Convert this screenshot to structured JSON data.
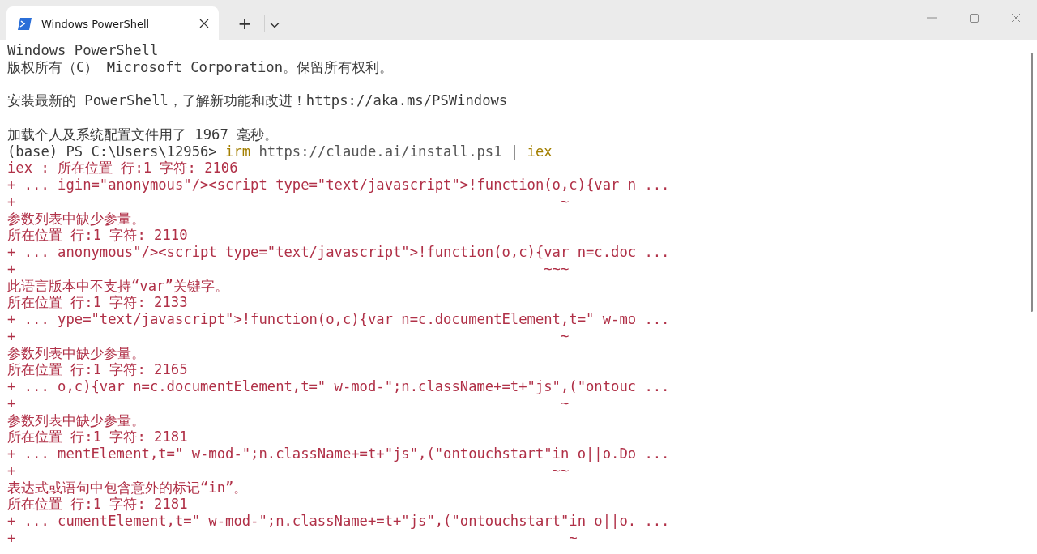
{
  "window": {
    "tabs": [
      {
        "title": "Windows PowerShell",
        "selected": true
      }
    ],
    "new_tab": "+"
  },
  "terminal": {
    "lines": [
      {
        "kind": "output",
        "text": "Windows PowerShell"
      },
      {
        "kind": "output",
        "text": "版权所有（C） Microsoft Corporation。保留所有权利。"
      },
      {
        "kind": "blank"
      },
      {
        "kind": "output",
        "text": "安装最新的 PowerShell，了解新功能和改进！https://aka.ms/PSWindows"
      },
      {
        "kind": "blank"
      },
      {
        "kind": "output",
        "text": "加载个人及系统配置文件用了 1967 毫秒。"
      },
      {
        "kind": "command",
        "segments": [
          {
            "kind": "prompt",
            "text": "(base) PS C:\\Users\\12956> "
          },
          {
            "kind": "cmdlet",
            "text": "irm"
          },
          {
            "kind": "arg",
            "text": " https://claude.ai/install.ps1 | "
          },
          {
            "kind": "cmdlet",
            "text": "iex"
          }
        ]
      },
      {
        "kind": "error",
        "text": "iex : 所在位置 行:1 字符: 2106"
      },
      {
        "kind": "error",
        "text": "+ ... igin=\"anonymous\"/><script type=\"text/javascript\">!function(o,c){var n ..."
      },
      {
        "kind": "error",
        "text": "+                                                                 ~"
      },
      {
        "kind": "error",
        "text": "参数列表中缺少参量。"
      },
      {
        "kind": "error",
        "text": "所在位置 行:1 字符: 2110"
      },
      {
        "kind": "error",
        "text": "+ ... anonymous\"/><script type=\"text/javascript\">!function(o,c){var n=c.doc ..."
      },
      {
        "kind": "error",
        "text": "+                                                               ~~~"
      },
      {
        "kind": "error",
        "text": "此语言版本中不支持“var”关键字。"
      },
      {
        "kind": "error",
        "text": "所在位置 行:1 字符: 2133"
      },
      {
        "kind": "error",
        "text": "+ ... ype=\"text/javascript\">!function(o,c){var n=c.documentElement,t=\" w-mo ..."
      },
      {
        "kind": "error",
        "text": "+                                                                 ~"
      },
      {
        "kind": "error",
        "text": "参数列表中缺少参量。"
      },
      {
        "kind": "error",
        "text": "所在位置 行:1 字符: 2165"
      },
      {
        "kind": "error",
        "text": "+ ... o,c){var n=c.documentElement,t=\" w-mod-\";n.className+=t+\"js\",(\"ontouc ..."
      },
      {
        "kind": "error",
        "text": "+                                                                 ~"
      },
      {
        "kind": "error",
        "text": "参数列表中缺少参量。"
      },
      {
        "kind": "error",
        "text": "所在位置 行:1 字符: 2181"
      },
      {
        "kind": "error",
        "text": "+ ... mentElement,t=\" w-mod-\";n.className+=t+\"js\",(\"ontouchstart\"in o||o.Do ..."
      },
      {
        "kind": "error",
        "text": "+                                                                ~~"
      },
      {
        "kind": "error",
        "text": "表达式或语句中包含意外的标记“in”。"
      },
      {
        "kind": "error",
        "text": "所在位置 行:1 字符: 2181"
      },
      {
        "kind": "error",
        "text": "+ ... cumentElement,t=\" w-mod-\";n.className+=t+\"js\",(\"ontouchstart\"in o||o. ..."
      },
      {
        "kind": "error",
        "text": "+                                                                  ~"
      }
    ]
  }
}
